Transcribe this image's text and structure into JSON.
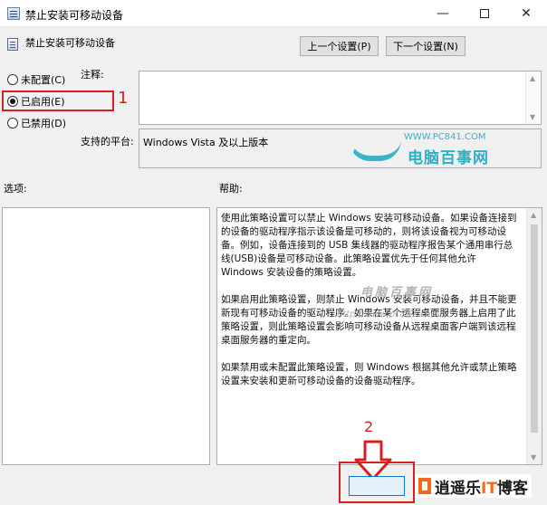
{
  "window": {
    "title": "禁止安装可移动设备",
    "min_glyph": "—",
    "close_glyph": "✕"
  },
  "policy": {
    "name": "禁止安装可移动设备"
  },
  "nav": {
    "prev_label": "上一个设置(P)",
    "next_label": "下一个设置(N)"
  },
  "options": {
    "not_configured": "未配置(C)",
    "enabled": "已启用(E)",
    "disabled": "已禁用(D)",
    "selected": "enabled"
  },
  "labels": {
    "comment": "注释:",
    "platform": "支持的平台:",
    "options": "选项:",
    "help": "帮助:"
  },
  "platform_value": "Windows Vista 及以上版本",
  "help_paragraphs": [
    "使用此策略设置可以禁止 Windows 安装可移动设备。如果设备连接到的设备的驱动程序指示该设备是可移动的，则将该设备视为可移动设备。例如，设备连接到的 USB 集线器的驱动程序报告某个通用串行总线(USB)设备是可移动设备。此策略设置优先于任何其他允许 Windows 安装设备的策略设置。",
    "如果启用此策略设置，则禁止 Windows 安装可移动设备，并且不能更新现有可移动设备的驱动程序。如果在某个远程桌面服务器上启用了此策略设置，则此策略设置会影响可移动设备从远程桌面客户端到该远程桌面服务器的重定向。",
    "如果禁用或未配置此策略设置，则 Windows 根据其他允许或禁止策略设置来安装和更新可移动设备的设备驱动程序。"
  ],
  "annotations": {
    "marker1": "1",
    "marker2": "2",
    "accent_color": "#d92020"
  },
  "watermarks": {
    "site_url": "WWW.PC841.COM",
    "site_name": "电脑百事网",
    "overlay_cn": "电脑百事网",
    "overlay_url": "http://www.pc841.com",
    "bottom_logo_a": "逍遥乐",
    "bottom_logo_b": "IT",
    "bottom_logo_c": "博客"
  }
}
